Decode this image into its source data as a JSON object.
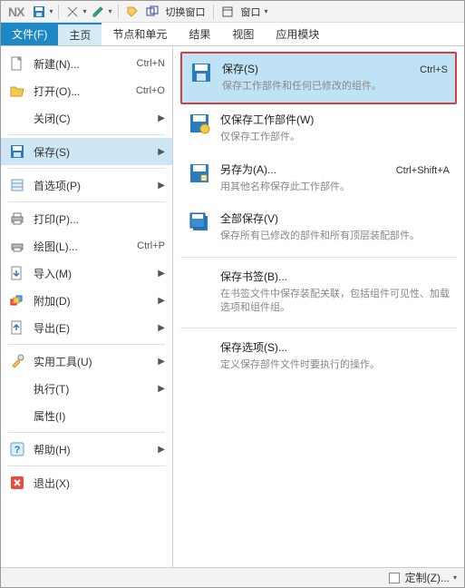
{
  "app": {
    "logo": "NX"
  },
  "toolbar": {
    "switch_window": "切换窗口",
    "window_menu": "窗口"
  },
  "ribbon": {
    "file": "文件(F)",
    "home": "主页",
    "nodes": "节点和单元",
    "results": "结果",
    "view": "视图",
    "modules": "应用模块"
  },
  "menu": {
    "new": {
      "label": "新建(N)...",
      "shortcut": "Ctrl+N"
    },
    "open": {
      "label": "打开(O)...",
      "shortcut": "Ctrl+O"
    },
    "close": {
      "label": "关闭(C)"
    },
    "save": {
      "label": "保存(S)"
    },
    "prefs": {
      "label": "首选项(P)"
    },
    "print": {
      "label": "打印(P)..."
    },
    "plot": {
      "label": "绘图(L)...",
      "shortcut": "Ctrl+P"
    },
    "import": {
      "label": "导入(M)"
    },
    "attach": {
      "label": "附加(D)"
    },
    "export": {
      "label": "导出(E)"
    },
    "tools": {
      "label": "实用工具(U)"
    },
    "exec": {
      "label": "执行(T)"
    },
    "props": {
      "label": "属性(I)"
    },
    "help": {
      "label": "帮助(H)"
    },
    "exit": {
      "label": "退出(X)"
    }
  },
  "submenu": {
    "save": {
      "title": "保存(S)",
      "shortcut": "Ctrl+S",
      "desc": "保存工作部件和任何已修改的组件。"
    },
    "save_work": {
      "title": "仅保存工作部件(W)",
      "desc": "仅保存工作部件。"
    },
    "save_as": {
      "title": "另存为(A)...",
      "shortcut": "Ctrl+Shift+A",
      "desc": "用其他名称保存此工作部件。"
    },
    "save_all": {
      "title": "全部保存(V)",
      "desc": "保存所有已修改的部件和所有顶层装配部件。"
    },
    "bookmark": {
      "title": "保存书签(B)...",
      "desc": "在书签文件中保存装配关联，包括组件可见性、加载选项和组件组。"
    },
    "save_opts": {
      "title": "保存选项(S)...",
      "desc": "定义保存部件文件时要执行的操作。"
    }
  },
  "statusbar": {
    "customize": "定制(Z)..."
  }
}
